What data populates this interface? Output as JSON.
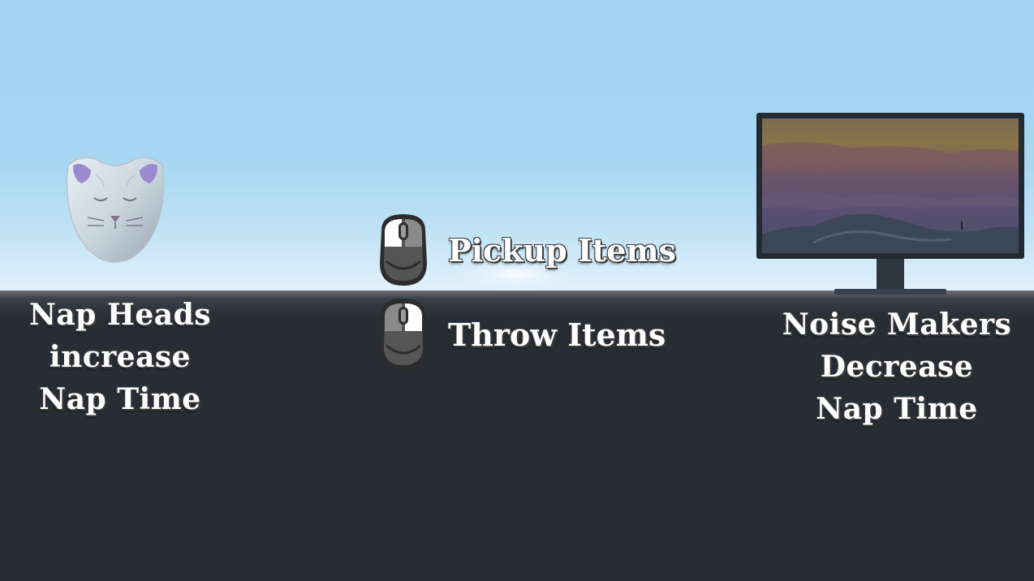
{
  "scene": {
    "colors": {
      "sky_top": "#a1d3f1",
      "floor": "#282d35",
      "text": "#ffffff",
      "text_outline": "#3a3a3a"
    }
  },
  "left_panel": {
    "icon": "nap-head-mask-icon",
    "label_lines": [
      "Nap Heads",
      "increase",
      "Nap Time"
    ]
  },
  "controls": [
    {
      "icon": "mouse-left-click-icon",
      "label": "Pickup Items"
    },
    {
      "icon": "mouse-right-click-icon",
      "label": "Throw Items"
    }
  ],
  "right_panel": {
    "icon": "monitor-noise-maker-icon",
    "label_lines": [
      "Noise Makers",
      "Decrease",
      "Nap Time"
    ]
  }
}
